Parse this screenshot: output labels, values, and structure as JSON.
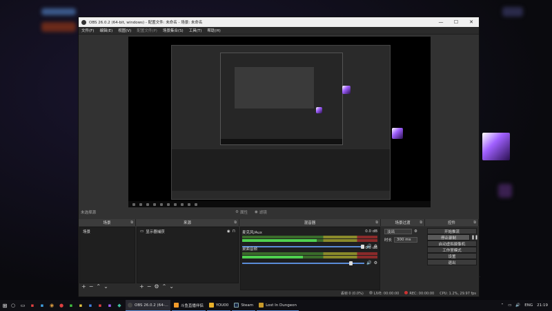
{
  "colors": {
    "accent": "#5a8cd8",
    "recording": "#cc3333",
    "crystal": "#a060ff"
  },
  "window": {
    "title": "OBS 26.0.2 (64-bit, windows) - 配置文件: 未命名 - 场景: 未命名",
    "controls": [
      "—",
      "☐",
      "✕"
    ]
  },
  "menu": [
    "文件(F)",
    "编辑(E)",
    "视图(V)",
    "配置文件(P)",
    "场景集合(S)",
    "工具(T)",
    "帮助(H)"
  ],
  "preview_toolbar": {
    "no_source": "未选择源",
    "properties": "属性",
    "filters": "滤镜"
  },
  "docks": {
    "scenes": {
      "title": "场景",
      "items": [
        "场景"
      ]
    },
    "sources": {
      "title": "来源",
      "items": [
        {
          "label": "显示器捕获"
        }
      ]
    },
    "mixer": {
      "title": "混音器",
      "tracks": [
        {
          "name": "麦克风/Aux",
          "db": "0.0 dB",
          "level": 0.55
        },
        {
          "name": "桌面音频",
          "db": "0.0 dB",
          "level": 0.45
        }
      ]
    },
    "transitions": {
      "title": "场景过渡",
      "type": "淡出",
      "duration_label": "时长",
      "duration_value": "300 ms"
    },
    "controls": {
      "title": "控件",
      "buttons": [
        "开始推流",
        "停止录制",
        "启动虚拟摄像机",
        "工作室模式",
        "设置",
        "退出"
      ]
    }
  },
  "status": {
    "dropped": "丢帧 0 (0.0%)",
    "live": "LIVE: 00:00:00",
    "rec": "REC: 00:00:00",
    "cpu": "CPU: 1.2%, 29.97 fps"
  },
  "taskbar": {
    "tasks": [
      {
        "label": "OBS 26.0.2 (64-...",
        "color": "#444",
        "active": true
      },
      {
        "label": "斗鱼直播伴侣",
        "color": "#f29b2a",
        "active": false
      },
      {
        "label": "YOU00",
        "color": "#e8b02a",
        "active": false
      },
      {
        "label": "Steam",
        "color": "#1b2a4a",
        "active": false
      },
      {
        "label": "Lost In Dungeon",
        "color": "#c89a2a",
        "active": false
      }
    ],
    "lang": "ENG",
    "time": "21:19"
  }
}
